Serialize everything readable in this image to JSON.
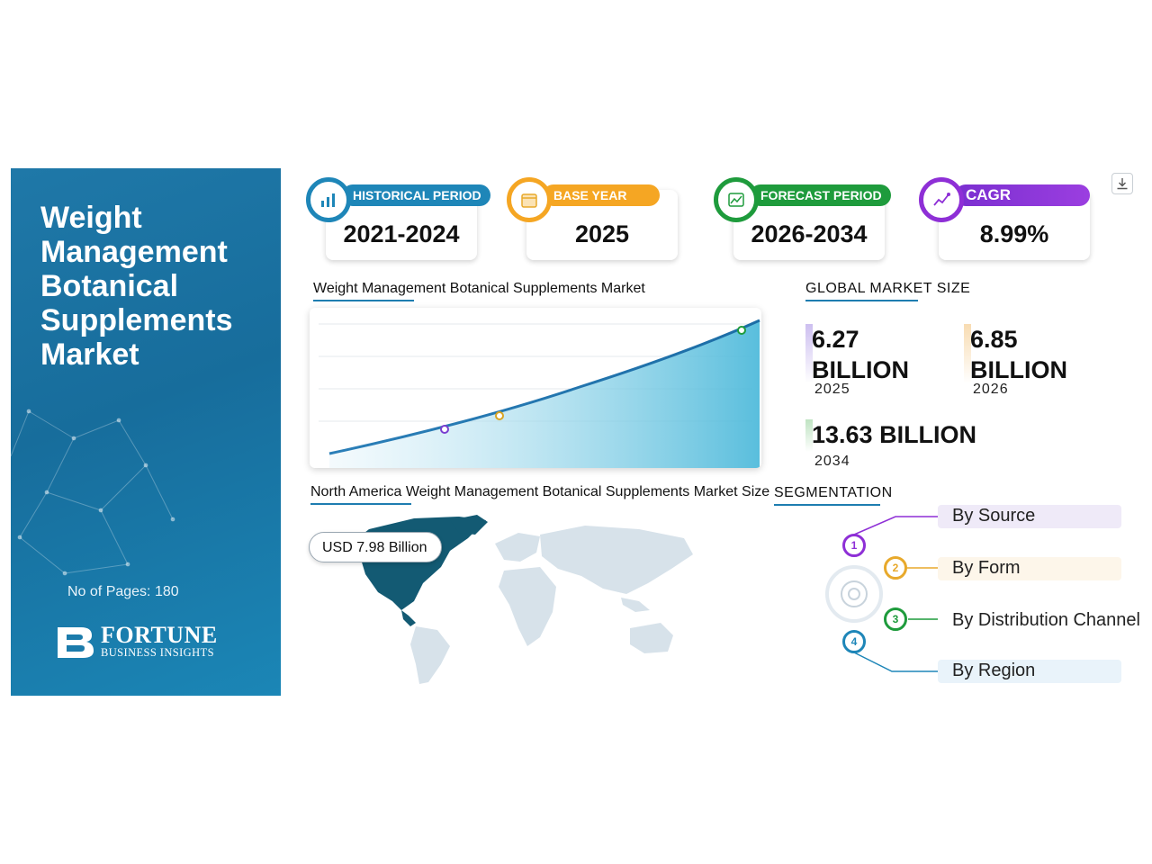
{
  "report": {
    "title": "Weight Management Botanical Supplements Market",
    "pages": "No of Pages: 180",
    "logo_line1": "FORTUNE",
    "logo_line2": "BUSINESS INSIGHTS"
  },
  "stats": [
    {
      "label": "HISTORICAL PERIOD",
      "value": "2021-2024",
      "color": "#1e86b8",
      "icon": "bar-chart-icon"
    },
    {
      "label": "BASE YEAR",
      "value": "2025",
      "color": "#f5a623",
      "icon": "calendar-icon"
    },
    {
      "label": "FORECAST PERIOD",
      "value": "2026-2034",
      "color": "#1e9b3c",
      "icon": "forecast-chart-icon"
    },
    {
      "label": "CAGR",
      "value": "8.99%",
      "color": "#8e2fd6",
      "icon": "growth-chart-icon"
    }
  ],
  "chart": {
    "title": "Weight Management Botanical Supplements Market"
  },
  "market_size": {
    "title": "GLOBAL MARKET SIZE",
    "items": [
      {
        "value": "6.27 BILLION",
        "year": "2025",
        "color": "#b8a8e6"
      },
      {
        "value": "6.85 BILLION",
        "year": "2026",
        "color": "#f7d9b0"
      },
      {
        "value": "13.63 BILLION",
        "year": "2034",
        "color": "#bfe3c2"
      }
    ]
  },
  "map": {
    "title": "North America Weight Management Botanical Supplements Market Size",
    "badge": "USD 7.98 Billion"
  },
  "segmentation": {
    "title": "SEGMENTATION",
    "items": [
      {
        "num": "1",
        "label": "By Source",
        "color": "#8e2fd6",
        "bg": "#efeaf8"
      },
      {
        "num": "2",
        "label": "By Form",
        "color": "#e8a92b",
        "bg": "#fdf6ea"
      },
      {
        "num": "3",
        "label": "By Distribution Channel",
        "color": "#1e9b3c",
        "bg": "#ffffff"
      },
      {
        "num": "4",
        "label": "By Region",
        "color": "#1e86b8",
        "bg": "#e9f3fa"
      }
    ]
  }
}
